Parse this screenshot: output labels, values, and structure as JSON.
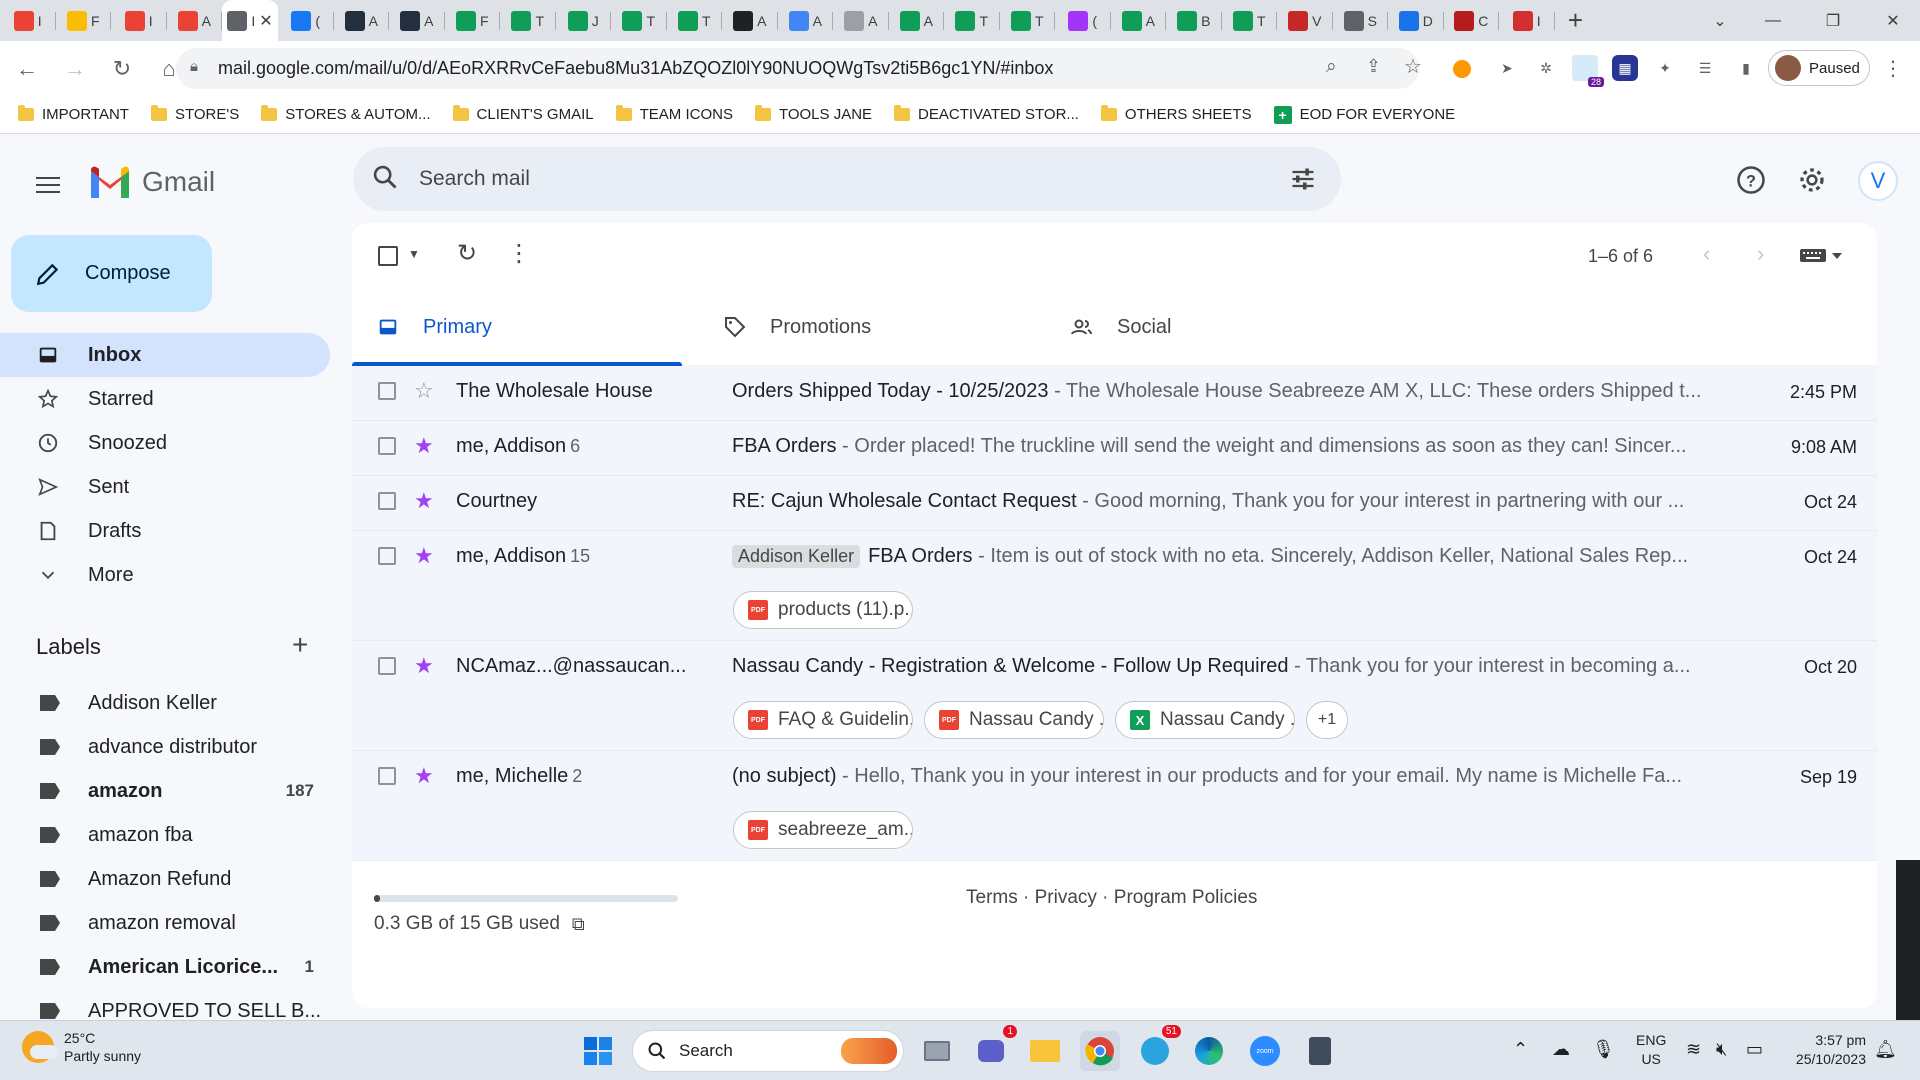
{
  "browser": {
    "tabs": [
      {
        "icon": "gmail-icon",
        "text": "I",
        "color": "#ea4335"
      },
      {
        "icon": "drive-icon",
        "text": "F",
        "color": "#fbbc04"
      },
      {
        "icon": "gmail-icon",
        "text": "I",
        "color": "#ea4335"
      },
      {
        "icon": "gmail-icon",
        "text": "A",
        "color": "#ea4335"
      },
      {
        "icon": "inbox-icon",
        "text": "I",
        "color": "#5f6368",
        "active": true
      },
      {
        "icon": "facebook-icon",
        "text": "(",
        "color": "#1877f2"
      },
      {
        "icon": "amazon-icon",
        "text": "A",
        "color": "#232f3e"
      },
      {
        "icon": "amazon-icon",
        "text": "A",
        "color": "#232f3e"
      },
      {
        "icon": "sheets-icon",
        "text": "F",
        "color": "#0f9d58"
      },
      {
        "icon": "sheets-icon",
        "text": "T",
        "color": "#0f9d58"
      },
      {
        "icon": "sheets-icon",
        "text": "J",
        "color": "#0f9d58"
      },
      {
        "icon": "sheets-icon",
        "text": "T",
        "color": "#0f9d58"
      },
      {
        "icon": "sheets-icon",
        "text": "T",
        "color": "#0f9d58"
      },
      {
        "icon": "chatgpt-icon",
        "text": "A",
        "color": "#202124"
      },
      {
        "icon": "pen-icon",
        "text": "A",
        "color": "#4285f4"
      },
      {
        "icon": "globe-icon",
        "text": "A",
        "color": "#9aa0a6"
      },
      {
        "icon": "sheets-icon",
        "text": "A",
        "color": "#0f9d58"
      },
      {
        "icon": "sheets-icon",
        "text": "T",
        "color": "#0f9d58"
      },
      {
        "icon": "sheets-icon",
        "text": "T",
        "color": "#0f9d58"
      },
      {
        "icon": "messenger-icon",
        "text": "(",
        "color": "#a334fa"
      },
      {
        "icon": "sheets-icon",
        "text": "A",
        "color": "#0f9d58"
      },
      {
        "icon": "sheets-icon",
        "text": "B",
        "color": "#0f9d58"
      },
      {
        "icon": "w-icon",
        "text": "T",
        "color": "#0f9d58"
      },
      {
        "icon": "w-red-icon",
        "text": "V",
        "color": "#c62828"
      },
      {
        "icon": "cloud-icon",
        "text": "S",
        "color": "#5f6368"
      },
      {
        "icon": "bird-icon",
        "text": "D",
        "color": "#1a73e8"
      },
      {
        "icon": "truck-icon",
        "text": "C",
        "color": "#b71c1c"
      },
      {
        "icon": "shield-icon",
        "text": "I",
        "color": "#d32f2f"
      }
    ],
    "url": "mail.google.com/mail/u/0/d/AEoRXRRvCeFaebu8Mu31AbZQOZl0lY90NUOQWgTsv2ti5B6gc1YN/#inbox",
    "profile_label": "Paused",
    "extension_badge": "28",
    "bookmarks": [
      {
        "label": "IMPORTANT",
        "type": "folder"
      },
      {
        "label": "STORE'S",
        "type": "folder"
      },
      {
        "label": "STORES & AUTOM...",
        "type": "folder"
      },
      {
        "label": "CLIENT'S GMAIL",
        "type": "folder"
      },
      {
        "label": "TEAM ICONS",
        "type": "folder"
      },
      {
        "label": "TOOLS JANE",
        "type": "folder"
      },
      {
        "label": "DEACTIVATED STOR...",
        "type": "folder"
      },
      {
        "label": "OTHERS SHEETS",
        "type": "folder"
      },
      {
        "label": "EOD FOR EVERYONE",
        "type": "sheet"
      }
    ]
  },
  "gmail": {
    "brand": "Gmail",
    "search_placeholder": "Search mail",
    "account_initial": "V",
    "compose_label": "Compose",
    "nav": [
      {
        "label": "Inbox",
        "icon": "inbox-icon",
        "selected": true
      },
      {
        "label": "Starred",
        "icon": "star-icon"
      },
      {
        "label": "Snoozed",
        "icon": "clock-icon"
      },
      {
        "label": "Sent",
        "icon": "send-icon"
      },
      {
        "label": "Drafts",
        "icon": "draft-icon"
      },
      {
        "label": "More",
        "icon": "chevron-down-icon"
      }
    ],
    "labels_heading": "Labels",
    "labels": [
      {
        "label": "Addison Keller",
        "count": "",
        "bold": false
      },
      {
        "label": "advance distributor",
        "count": "",
        "bold": false
      },
      {
        "label": "amazon",
        "count": "187",
        "bold": true
      },
      {
        "label": "amazon fba",
        "count": "",
        "bold": false
      },
      {
        "label": "Amazon Refund",
        "count": "",
        "bold": false
      },
      {
        "label": "amazon removal",
        "count": "",
        "bold": false
      },
      {
        "label": "American Licorice...",
        "count": "1",
        "bold": true
      },
      {
        "label": "APPROVED TO SELL B...",
        "count": "",
        "bold": false
      }
    ],
    "page_info": "1–6 of 6",
    "tabs": [
      {
        "label": "Primary",
        "icon": "inbox-tab-icon",
        "selected": true
      },
      {
        "label": "Promotions",
        "icon": "tag-icon"
      },
      {
        "label": "Social",
        "icon": "people-icon"
      }
    ],
    "emails": [
      {
        "from": "The Wholesale House",
        "count": "",
        "starred": false,
        "chip": "",
        "subject": "Orders Shipped Today - 10/25/2023",
        "snippet": " - The Wholesale House Seabreeze AM X, LLC: These orders Shipped t...",
        "time": "2:45 PM",
        "attachments": []
      },
      {
        "from": "me, Addison",
        "count": "6",
        "starred": true,
        "chip": "",
        "subject": "FBA Orders",
        "snippet": " - Order placed! The truckline will send the weight and dimensions as soon as they can! Sincer...",
        "time": "9:08 AM",
        "attachments": []
      },
      {
        "from": "Courtney",
        "count": "",
        "starred": true,
        "chip": "",
        "subject": "RE: Cajun Wholesale Contact Request",
        "snippet": " - Good morning, Thank you for your interest in partnering with our ...",
        "time": "Oct 24",
        "attachments": []
      },
      {
        "from": "me, Addison",
        "count": "15",
        "starred": true,
        "chip": "Addison Keller",
        "subject": "FBA Orders",
        "snippet": " - Item is out of stock with no eta. Sincerely, Addison Keller, National Sales Rep...",
        "time": "Oct 24",
        "attachments": [
          {
            "name": "products (11).p...",
            "type": "pdf"
          }
        ]
      },
      {
        "from": "NCAmaz...@nassaucan...",
        "count": "",
        "starred": true,
        "chip": "",
        "subject": "Nassau Candy - Registration & Welcome - Follow Up Required",
        "snippet": " - Thank you for your interest in becoming a...",
        "time": "Oct 20",
        "attachments": [
          {
            "name": "FAQ & Guidelin...",
            "type": "pdf"
          },
          {
            "name": "Nassau Candy ...",
            "type": "pdf"
          },
          {
            "name": "Nassau Candy ...",
            "type": "xls"
          }
        ],
        "more": "+1"
      },
      {
        "from": "me, Michelle",
        "count": "2",
        "starred": true,
        "chip": "",
        "subject": "(no subject)",
        "snippet": " - Hello, Thank you in your interest in our products and for your email. My name is Michelle Fa...",
        "time": "Sep 19",
        "attachments": [
          {
            "name": "seabreeze_am...",
            "type": "pdf"
          }
        ]
      }
    ],
    "storage_text": "0.3 GB of 15 GB used",
    "storage_fraction": 0.02,
    "footer": "Terms · Privacy · Program Policies"
  },
  "taskbar": {
    "temperature": "25°C",
    "weather": "Partly sunny",
    "search_label": "Search",
    "lang_line1": "ENG",
    "lang_line2": "US",
    "time": "3:57 pm",
    "date": "25/10/2023",
    "teams_badge": "1",
    "telegram_badge": "51"
  }
}
